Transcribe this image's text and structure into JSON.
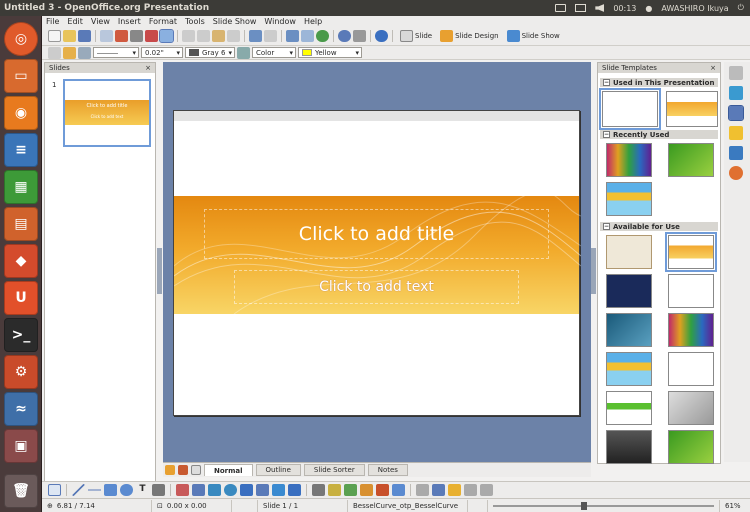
{
  "window": {
    "title": "Untitled 3 - OpenOffice.org Presentation"
  },
  "system": {
    "time": "00:13",
    "user": "AWASHIRO Ikuya"
  },
  "menu": [
    "File",
    "Edit",
    "View",
    "Insert",
    "Format",
    "Tools",
    "Slide Show",
    "Window",
    "Help"
  ],
  "toolbar": {
    "slide_label": "Slide",
    "slide_design_label": "Slide Design",
    "slide_show_label": "Slide Show"
  },
  "format_toolbar": {
    "line_width": "0.02\"",
    "line_color": "Gray 6",
    "area_style": "Color",
    "area_color": "Yellow"
  },
  "slides_pane": {
    "title": "Slides",
    "close": "×",
    "slide_number": "1",
    "thumb_title": "Click to add title",
    "thumb_text": "Click to add text"
  },
  "slide": {
    "title_placeholder": "Click to add title",
    "text_placeholder": "Click to add text"
  },
  "view_tabs": [
    "Normal",
    "Outline",
    "Slide Sorter",
    "Notes"
  ],
  "templates_pane": {
    "title": "Slide Templates",
    "close": "×",
    "sections": [
      "Used in This Presentation",
      "Recently Used",
      "Available for Use"
    ]
  },
  "status": {
    "position": "6.81 / 7.14",
    "size": "0.00 x 0.00",
    "slide_info": "Slide 1 / 1",
    "layout": "BesselCurve_otp_BesselCurve",
    "zoom": "61%"
  },
  "colors": {
    "accent": "#e48810",
    "topbar": "#3c3b37",
    "launcher": "#4a3b3b",
    "canvas": "#6c82a8"
  }
}
